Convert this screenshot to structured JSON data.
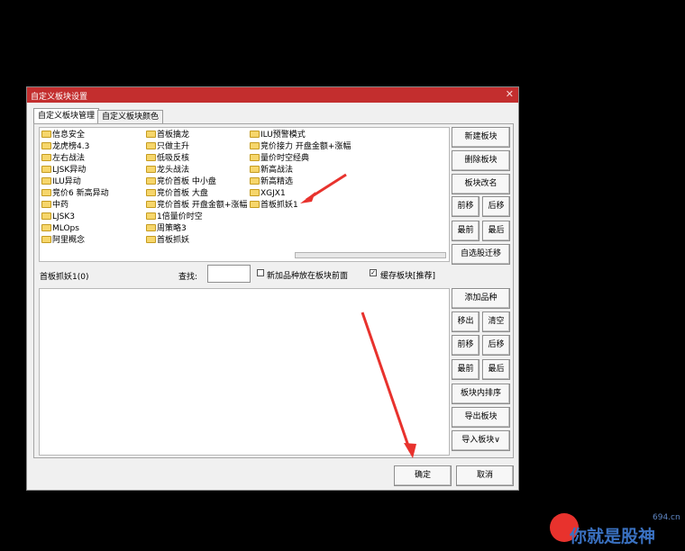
{
  "dialog": {
    "title": "自定义板块设置",
    "close_glyph": "✕",
    "tabs": [
      {
        "label": "自定义板块管理",
        "active": true
      },
      {
        "label": "自定义板块颜色",
        "active": false
      }
    ],
    "blocks": [
      "信息安全",
      "龙虎榜4.3",
      "左右战法",
      "LJSK异动",
      "ILU异动",
      "竞价6 新高异动",
      "中药",
      "LJSK3",
      "MLOps",
      "阿里概念",
      "首板擒龙",
      "只做主升",
      "低吸反核",
      "龙头战法",
      "竞价首板 中小盘",
      "竞价首板 大盘",
      "竞价首板 开盘金额+涨幅",
      "1倍量价时空",
      "周策略3",
      "首板抓妖",
      "ILU预警模式",
      "竞价接力 开盘金额+涨幅",
      "量价时空经典",
      "新高战法",
      "新高精选",
      "XGJX1",
      "首板抓妖1"
    ],
    "side_buttons_top": {
      "new": "新建板块",
      "delete": "删除板块",
      "rename": "板块改名",
      "move_up": "前移",
      "move_down": "后移",
      "to_front": "最前",
      "to_back": "最后",
      "migrate": "自选股迁移"
    },
    "selected_block_label": "首板抓妖1(0)",
    "search_label": "查找:",
    "search_value": "",
    "option_new_front": {
      "label": "新加品种放在板块前面",
      "checked": false
    },
    "option_cache": {
      "label": "缓存板块[推荐]",
      "checked": true
    },
    "side_buttons_bottom": {
      "add": "添加品种",
      "remove": "移出",
      "clear": "清空",
      "move_up": "前移",
      "move_down": "后移",
      "to_front": "最前",
      "to_back": "最后",
      "sort": "板块内排序",
      "export": "导出板块",
      "import": "导入板块∨"
    },
    "ok": "确定",
    "cancel": "取消"
  },
  "watermark": {
    "text": "你就是股神",
    "domain": "694.cn"
  },
  "colors": {
    "titlebar": "#c32e2e",
    "arrow": "#e8322d"
  }
}
